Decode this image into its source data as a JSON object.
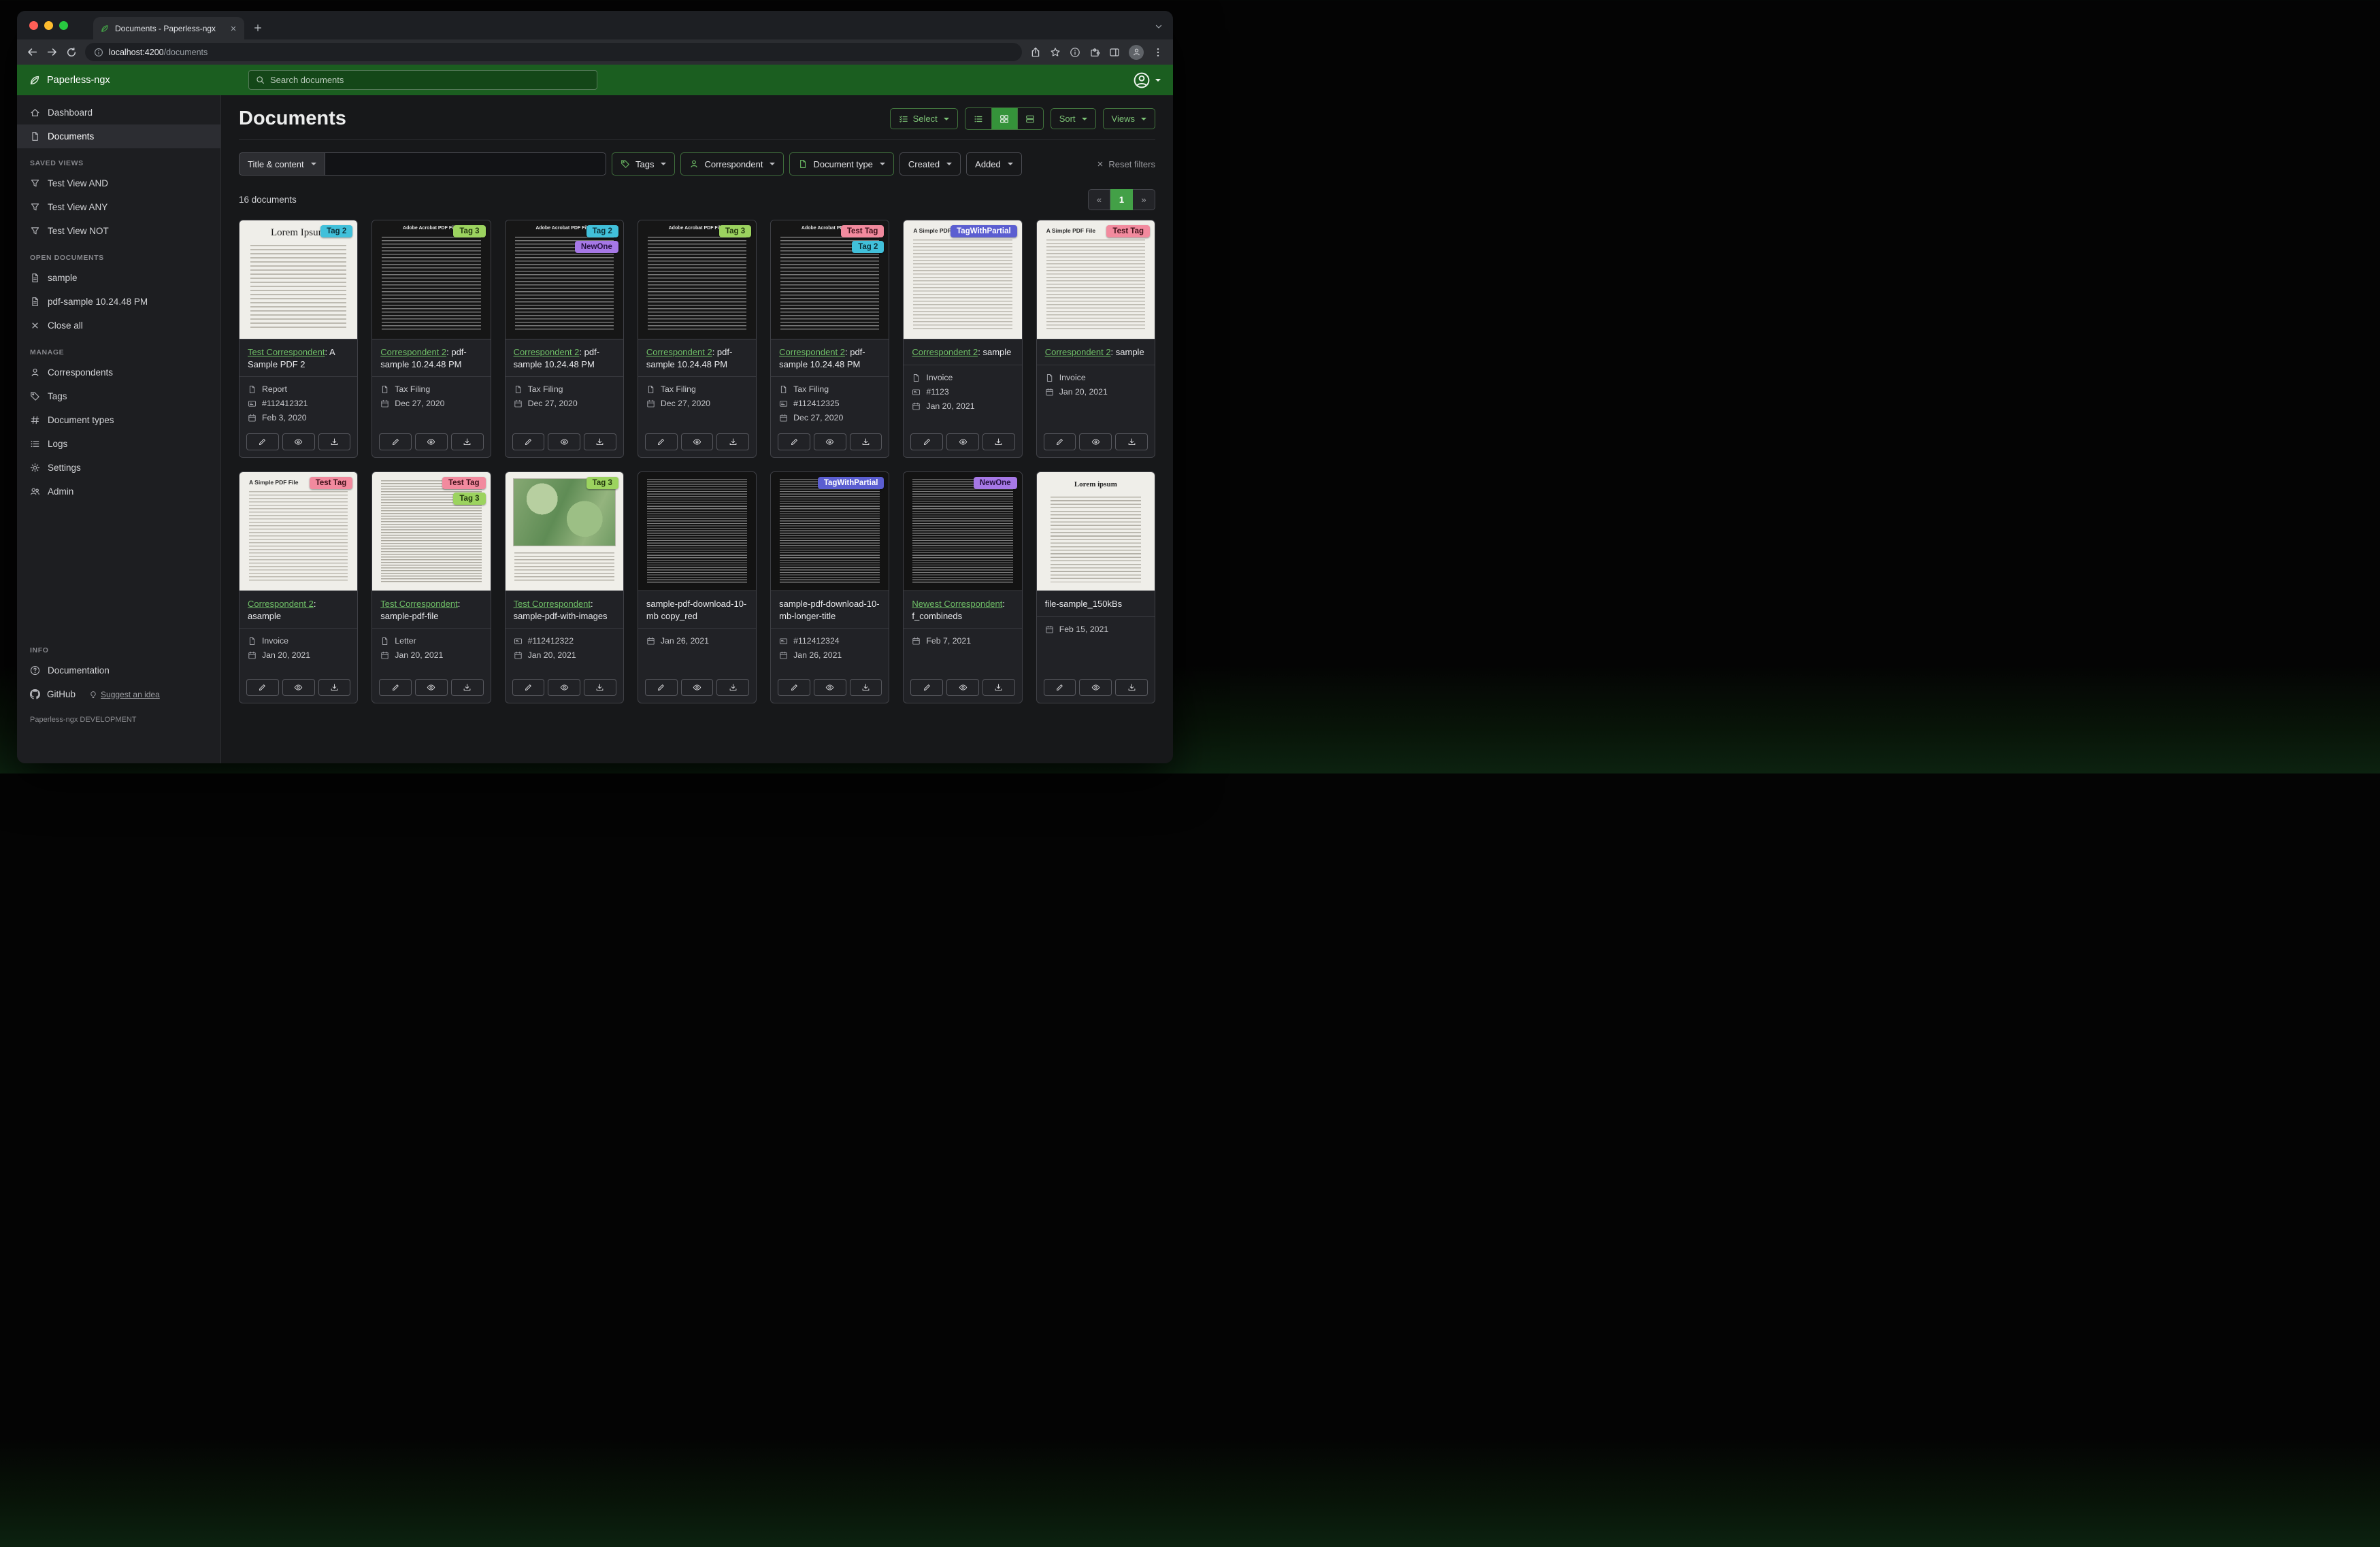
{
  "browser": {
    "tab": {
      "title": "Documents - Paperless-ngx"
    },
    "url_host": "localhost:4200",
    "url_path": "/documents"
  },
  "header": {
    "brand": "Paperless-ngx",
    "search_placeholder": "Search documents"
  },
  "sidebar": {
    "dashboard": "Dashboard",
    "documents": "Documents",
    "saved_views_title": "SAVED VIEWS",
    "saved_views": [
      "Test View AND",
      "Test View ANY",
      "Test View NOT"
    ],
    "open_documents_title": "OPEN DOCUMENTS",
    "open_documents": [
      "sample",
      "pdf-sample 10.24.48 PM"
    ],
    "close_all": "Close all",
    "manage_title": "MANAGE",
    "manage": [
      "Correspondents",
      "Tags",
      "Document types",
      "Logs",
      "Settings",
      "Admin"
    ],
    "info_title": "INFO",
    "documentation": "Documentation",
    "github": "GitHub",
    "suggest": "Suggest an idea",
    "footer": "Paperless-ngx DEVELOPMENT"
  },
  "main": {
    "title": "Documents",
    "toolbar": {
      "select": "Select",
      "sort": "Sort",
      "views": "Views"
    },
    "filters": {
      "title_dropdown": "Title & content",
      "tags": "Tags",
      "correspondent": "Correspondent",
      "document_type": "Document type",
      "created": "Created",
      "added": "Added",
      "reset": "Reset filters"
    },
    "count": "16 documents",
    "pagination": {
      "prev": "«",
      "page": "1",
      "next": "»"
    }
  },
  "tag_colors": {
    "Tag 2": {
      "bg": "#41c0da",
      "fg": "#0c3038"
    },
    "Tag 3": {
      "bg": "#9cd35f",
      "fg": "#23380f"
    },
    "NewOne": {
      "bg": "#a678e6",
      "fg": "#241040"
    },
    "Test Tag": {
      "bg": "#f28a9e",
      "fg": "#3f1019"
    },
    "TagWithPartial": {
      "bg": "#5b5ed1",
      "fg": "#ffffff"
    }
  },
  "documents": [
    {
      "tags": [
        "Tag 2"
      ],
      "title_link": "Test Correspondent",
      "title_rest": ": A Sample PDF 2",
      "type": "Report",
      "asn": "#112412321",
      "date": "Feb 3, 2020",
      "thumb": {
        "style": "light-serif",
        "heading": "Lorem Ipsum"
      }
    },
    {
      "tags": [
        "Tag 3"
      ],
      "title_link": "Correspondent 2",
      "title_rest": ": pdf-sample 10.24.48 PM",
      "type": "Tax Filing",
      "date": "Dec 27, 2020",
      "thumb": {
        "style": "dark",
        "heading": "Adobe Acrobat PDF Files"
      }
    },
    {
      "tags": [
        "Tag 2",
        "NewOne"
      ],
      "title_link": "Correspondent 2",
      "title_rest": ": pdf-sample 10.24.48 PM",
      "type": "Tax Filing",
      "date": "Dec 27, 2020",
      "thumb": {
        "style": "dark",
        "heading": "Adobe Acrobat PDF Files"
      }
    },
    {
      "tags": [
        "Tag 3"
      ],
      "title_link": "Correspondent 2",
      "title_rest": ": pdf-sample 10.24.48 PM",
      "type": "Tax Filing",
      "date": "Dec 27, 2020",
      "thumb": {
        "style": "dark",
        "heading": "Adobe Acrobat PDF Files"
      }
    },
    {
      "tags": [
        "Test Tag",
        "Tag 2"
      ],
      "title_link": "Correspondent 2",
      "title_rest": ": pdf-sample 10.24.48 PM",
      "type": "Tax Filing",
      "asn": "#112412325",
      "date": "Dec 27, 2020",
      "thumb": {
        "style": "dark",
        "heading": "Adobe Acrobat PDF Files"
      }
    },
    {
      "tags": [
        "TagWithPartial"
      ],
      "title_link": "Correspondent 2",
      "title_rest": ": sample",
      "type": "Invoice",
      "asn": "#1123",
      "date": "Jan 20, 2021",
      "thumb": {
        "style": "light-small",
        "heading": "A Simple PDF File"
      }
    },
    {
      "tags": [
        "Test Tag"
      ],
      "title_link": "Correspondent 2",
      "title_rest": ": sample",
      "type": "Invoice",
      "date": "Jan 20, 2021",
      "thumb": {
        "style": "light-small",
        "heading": "A Simple PDF File"
      }
    },
    {
      "tags": [
        "Test Tag"
      ],
      "title_link": "Correspondent 2",
      "title_rest": ": asample",
      "type": "Invoice",
      "date": "Jan 20, 2021",
      "thumb": {
        "style": "light-small",
        "heading": "A Simple PDF File"
      }
    },
    {
      "tags": [
        "Test Tag",
        "Tag 3"
      ],
      "title_link": "Test Correspondent",
      "title_rest": ": sample-pdf-file",
      "type": "Letter",
      "date": "Jan 20, 2021",
      "thumb": {
        "style": "light-dense",
        "heading": ""
      }
    },
    {
      "tags": [
        "Tag 3"
      ],
      "title_link": "Test Correspondent",
      "title_rest": ": sample-pdf-with-images",
      "asn": "#112412322",
      "date": "Jan 20, 2021",
      "thumb": {
        "style": "map",
        "heading": ""
      }
    },
    {
      "tags": [],
      "title_rest": "sample-pdf-download-10-mb copy_red",
      "date": "Jan 26, 2021",
      "thumb": {
        "style": "dark-dense",
        "heading": ""
      }
    },
    {
      "tags": [
        "TagWithPartial"
      ],
      "title_rest": "sample-pdf-download-10-mb-longer-title",
      "asn": "#112412324",
      "date": "Jan 26, 2021",
      "thumb": {
        "style": "dark-dense",
        "heading": ""
      }
    },
    {
      "tags": [
        "NewOne"
      ],
      "title_link": "Newest Correspondent",
      "title_rest": ": f_combineds",
      "date": "Feb 7, 2021",
      "thumb": {
        "style": "dark-dense",
        "heading": ""
      }
    },
    {
      "tags": [],
      "title_rest": "file-sample_150kBs",
      "date": "Feb 15, 2021",
      "thumb": {
        "style": "light-center",
        "heading": "Lorem ipsum"
      }
    }
  ]
}
